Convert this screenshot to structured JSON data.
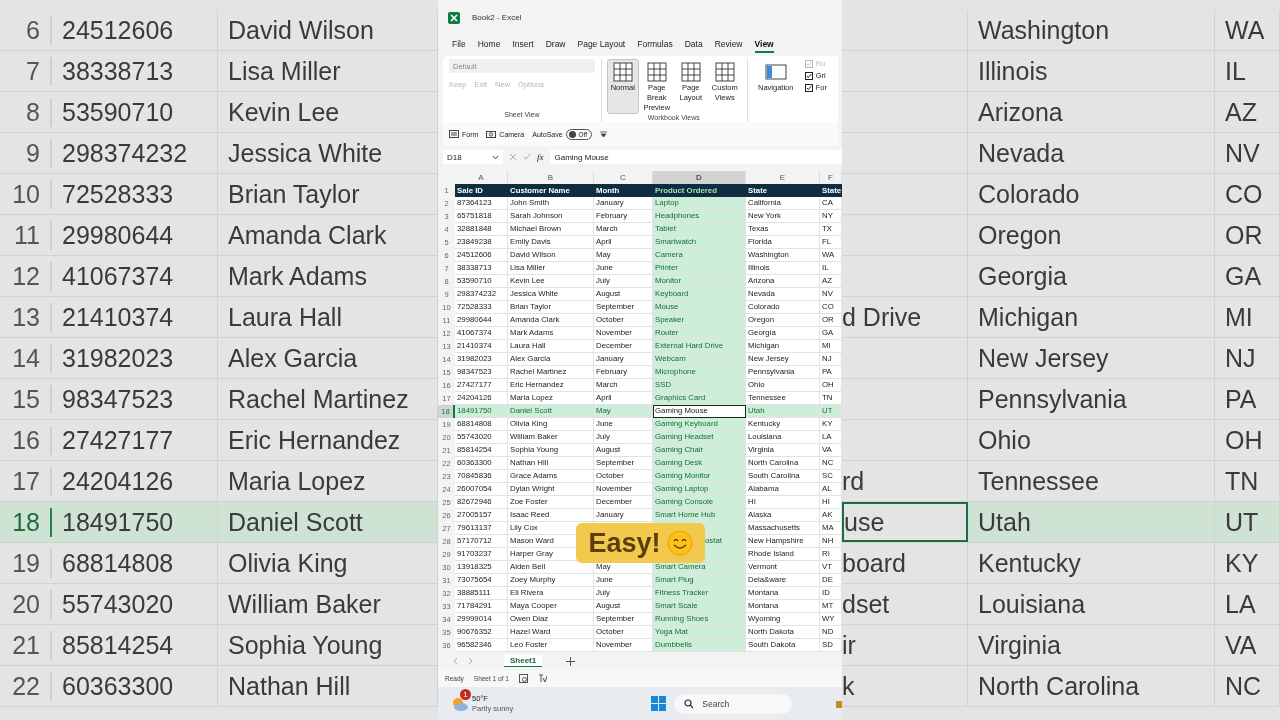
{
  "background_left": {
    "rows": [
      {
        "row": "6",
        "id": "24512606",
        "name": "David Wilson",
        "selected": false
      },
      {
        "row": "7",
        "id": "38338713",
        "name": "Lisa Miller",
        "selected": false
      },
      {
        "row": "8",
        "id": "53590710",
        "name": "Kevin Lee",
        "selected": false
      },
      {
        "row": "9",
        "id": "298374232",
        "name": "Jessica White",
        "selected": false
      },
      {
        "row": "10",
        "id": "72528333",
        "name": "Brian Taylor",
        "selected": false
      },
      {
        "row": "11",
        "id": "29980644",
        "name": "Amanda Clark",
        "selected": false
      },
      {
        "row": "12",
        "id": "41067374",
        "name": "Mark Adams",
        "selected": false
      },
      {
        "row": "13",
        "id": "21410374",
        "name": "Laura Hall",
        "selected": false
      },
      {
        "row": "14",
        "id": "31982023",
        "name": "Alex Garcia",
        "selected": false
      },
      {
        "row": "15",
        "id": "98347523",
        "name": "Rachel Martinez",
        "selected": false
      },
      {
        "row": "16",
        "id": "27427177",
        "name": "Eric Hernandez",
        "selected": false
      },
      {
        "row": "17",
        "id": "24204126",
        "name": "Maria Lopez",
        "selected": false
      },
      {
        "row": "18",
        "id": "18491750",
        "name": "Daniel Scott",
        "selected": true
      },
      {
        "row": "19",
        "id": "68814808",
        "name": "Olivia King",
        "selected": false
      },
      {
        "row": "20",
        "id": "55743020",
        "name": "William Baker",
        "selected": false
      },
      {
        "row": "21",
        "id": "85814254",
        "name": "Sophia Young",
        "selected": false
      },
      {
        "row": "22",
        "id": "60363300",
        "name": "Nathan Hill",
        "selected": false
      }
    ]
  },
  "window": {
    "title": "Book2 - Excel"
  },
  "menu": [
    {
      "label": "File",
      "selected": false
    },
    {
      "label": "Home",
      "selected": false
    },
    {
      "label": "Insert",
      "selected": false
    },
    {
      "label": "Draw",
      "selected": false
    },
    {
      "label": "Page Layout",
      "selected": false
    },
    {
      "label": "Formulas",
      "selected": false
    },
    {
      "label": "Data",
      "selected": false
    },
    {
      "label": "Review",
      "selected": false
    },
    {
      "label": "View",
      "selected": true
    }
  ],
  "ribbon": {
    "sheet_view": {
      "dropdown": "Default",
      "buttons": [
        "Keep",
        "Exit",
        "New",
        "Options"
      ],
      "label": "Sheet View"
    },
    "workbook_views": {
      "buttons": [
        {
          "label": "Normal",
          "selected": true
        },
        {
          "label": "Page Break Preview",
          "selected": false
        },
        {
          "label": "Page Layout",
          "selected": false
        },
        {
          "label": "Custom Views",
          "selected": false
        }
      ],
      "label": "Workbook Views"
    },
    "show": {
      "navigation": "Navigation",
      "checkboxes": [
        {
          "label": "Ru",
          "checked": true,
          "disabled": true
        },
        {
          "label": "Gri",
          "checked": true,
          "disabled": false
        },
        {
          "label": "For",
          "checked": true,
          "disabled": false
        }
      ]
    }
  },
  "quick_access": {
    "form": "Form",
    "camera": "Camera",
    "autosave": {
      "label": "AutoSave",
      "on": false,
      "state": "Off"
    }
  },
  "formula_bar": {
    "name_box": "D18",
    "fx": "fx",
    "value": "Gaming Mouse"
  },
  "sheet": {
    "columns": [
      {
        "letter": "A",
        "selected": false
      },
      {
        "letter": "B",
        "selected": false
      },
      {
        "letter": "C",
        "selected": false
      },
      {
        "letter": "D",
        "selected": true
      },
      {
        "letter": "E",
        "selected": false
      },
      {
        "letter": "F",
        "selected": false
      }
    ],
    "header": {
      "row": "1",
      "cells": [
        "Sale ID",
        "Customer Name",
        "Month",
        "Product Ordered",
        "State",
        "State"
      ]
    },
    "rows": [
      {
        "row": "2",
        "selected": false,
        "cells": [
          "87364123",
          "John Smith",
          "January",
          "Laptop",
          "California",
          "CA"
        ]
      },
      {
        "row": "3",
        "selected": false,
        "cells": [
          "65751818",
          "Sarah Johnson",
          "February",
          "Headphones",
          "New York",
          "NY"
        ]
      },
      {
        "row": "4",
        "selected": false,
        "cells": [
          "32881848",
          "Michael Brown",
          "March",
          "Tablet",
          "Texas",
          "TX"
        ]
      },
      {
        "row": "5",
        "selected": false,
        "cells": [
          "23849238",
          "Emily Davis",
          "April",
          "Smartwatch",
          "Florida",
          "FL"
        ]
      },
      {
        "row": "6",
        "selected": false,
        "cells": [
          "24512606",
          "David Wilson",
          "May",
          "Camera",
          "Washington",
          "WA"
        ]
      },
      {
        "row": "7",
        "selected": false,
        "cells": [
          "38338713",
          "Lisa Miller",
          "June",
          "Printer",
          "Illinois",
          "IL"
        ]
      },
      {
        "row": "8",
        "selected": false,
        "cells": [
          "53590710",
          "Kevin Lee",
          "July",
          "Monitor",
          "Arizona",
          "AZ"
        ]
      },
      {
        "row": "9",
        "selected": false,
        "cells": [
          "298374232",
          "Jessica White",
          "August",
          "Keyboard",
          "Nevada",
          "NV"
        ]
      },
      {
        "row": "10",
        "selected": false,
        "cells": [
          "72528333",
          "Brian Taylor",
          "September",
          "Mouse",
          "Colorado",
          "CO"
        ]
      },
      {
        "row": "11",
        "selected": false,
        "cells": [
          "29980644",
          "Amanda Clark",
          "October",
          "Speaker",
          "Oregon",
          "OR"
        ]
      },
      {
        "row": "12",
        "selected": false,
        "cells": [
          "41067374",
          "Mark Adams",
          "November",
          "Router",
          "Georgia",
          "GA"
        ]
      },
      {
        "row": "13",
        "selected": false,
        "cells": [
          "21410374",
          "Laura Hall",
          "December",
          "External Hard Drive",
          "Michigan",
          "MI"
        ]
      },
      {
        "row": "14",
        "selected": false,
        "cells": [
          "31982023",
          "Alex Garcia",
          "January",
          "Webcam",
          "New Jersey",
          "NJ"
        ]
      },
      {
        "row": "15",
        "selected": false,
        "cells": [
          "98347523",
          "Rachel Martinez",
          "February",
          "Microphone",
          "Pennsylvania",
          "PA"
        ]
      },
      {
        "row": "16",
        "selected": false,
        "cells": [
          "27427177",
          "Eric Hernandez",
          "March",
          "SSD",
          "Ohio",
          "OH"
        ]
      },
      {
        "row": "17",
        "selected": false,
        "cells": [
          "24204126",
          "Maria Lopez",
          "April",
          "Graphics Card",
          "Tennessee",
          "TN"
        ]
      },
      {
        "row": "18",
        "selected": true,
        "cells": [
          "18491750",
          "Daniel Scott",
          "May",
          "Gaming Mouse",
          "Utah",
          "UT"
        ]
      },
      {
        "row": "19",
        "selected": false,
        "cells": [
          "68814808",
          "Olivia King",
          "June",
          "Gaming Keyboard",
          "Kentucky",
          "KY"
        ]
      },
      {
        "row": "20",
        "selected": false,
        "cells": [
          "55743020",
          "William Baker",
          "July",
          "Gaming Headset",
          "Louisiana",
          "LA"
        ]
      },
      {
        "row": "21",
        "selected": false,
        "cells": [
          "85814254",
          "Sophia Young",
          "August",
          "Gaming Chair",
          "Virginia",
          "VA"
        ]
      },
      {
        "row": "22",
        "selected": false,
        "cells": [
          "60363300",
          "Nathan Hill",
          "September",
          "Gaming Desk",
          "North Carolina",
          "NC"
        ]
      },
      {
        "row": "23",
        "selected": false,
        "cells": [
          "70845836",
          "Grace Adams",
          "October",
          "Gaming Monitor",
          "South Carolina",
          "SC"
        ]
      },
      {
        "row": "24",
        "selected": false,
        "cells": [
          "26007054",
          "Dylan Wright",
          "November",
          "Gaming Laptop",
          "Alabama",
          "AL"
        ]
      },
      {
        "row": "25",
        "selected": false,
        "cells": [
          "82672946",
          "Zoe Foster",
          "December",
          "Gaming Console",
          "HI",
          "HI"
        ]
      },
      {
        "row": "26",
        "selected": false,
        "cells": [
          "27005157",
          "Isaac Reed",
          "January",
          "Smart Home Hub",
          "Alaska",
          "AK"
        ]
      },
      {
        "row": "27",
        "selected": false,
        "cells": [
          "79613137",
          "Lily Cox",
          null,
          null,
          "Massachusetts",
          "MA"
        ]
      },
      {
        "row": "28",
        "selected": false,
        "cells": [
          "57170712",
          "Mason Ward",
          null,
          {
            "text": "ostat",
            "covered_left": true
          },
          "New Hampshire",
          "NH"
        ]
      },
      {
        "row": "29",
        "selected": false,
        "cells": [
          "91703237",
          "Harper Gray",
          null,
          null,
          "Rhode Island",
          "RI"
        ]
      },
      {
        "row": "30",
        "selected": false,
        "cells": [
          "13918325",
          "Aiden Bell",
          "May",
          "Smart Camera",
          "Vermont",
          "VT"
        ]
      },
      {
        "row": "31",
        "selected": false,
        "cells": [
          "73075654",
          "Zoey Murphy",
          "June",
          "Smart Plug",
          "Dela&ware",
          "DE"
        ]
      },
      {
        "row": "32",
        "selected": false,
        "cells": [
          "38885111",
          "Eli Rivera",
          "July",
          "Fitness Tracker",
          "Montana",
          "ID"
        ]
      },
      {
        "row": "33",
        "selected": false,
        "cells": [
          "71784291",
          "Maya Cooper",
          "August",
          "Smart Scale",
          "Montana",
          "MT"
        ]
      },
      {
        "row": "34",
        "selected": false,
        "cells": [
          "29999014",
          "Owen Diaz",
          "September",
          "Running Shoes",
          "Wyoming",
          "WY"
        ]
      },
      {
        "row": "35",
        "selected": false,
        "cells": [
          "90676352",
          "Hazel Ward",
          "October",
          "Yoga Mat",
          "North Dakota",
          "ND"
        ]
      },
      {
        "row": "36",
        "selected": false,
        "cells": [
          "96582346",
          "Leo Foster",
          "November",
          "Dumbbells",
          "South Dakota",
          "SD"
        ]
      }
    ]
  },
  "caption": {
    "text": "Easy!"
  },
  "sheet_tabs": [
    {
      "label": "Sheet1",
      "selected": true
    }
  ],
  "status_bar": {
    "mode": "Ready",
    "sheet_count": "Sheet 1 of 1"
  },
  "taskbar": {
    "weather": {
      "badge": "1",
      "temperature": "50°F",
      "condition": "Partly sunny"
    },
    "search": "Search"
  },
  "background_right": {
    "rows": [
      {
        "state": "Washington",
        "abbr": "WA",
        "selected": false
      },
      {
        "state": "Illinois",
        "abbr": "IL",
        "selected": false
      },
      {
        "state": "Arizona",
        "abbr": "AZ",
        "selected": false
      },
      {
        "state": "Nevada",
        "abbr": "NV",
        "selected": false
      },
      {
        "state": "Colorado",
        "abbr": "CO",
        "selected": false
      },
      {
        "state": "Oregon",
        "abbr": "OR",
        "selected": false
      },
      {
        "state": "Georgia",
        "abbr": "GA",
        "selected": false
      },
      {
        "product": "d Drive",
        "state": "Michigan",
        "abbr": "MI",
        "selected": false
      },
      {
        "state": "New Jersey",
        "abbr": "NJ",
        "selected": false
      },
      {
        "state": "Pennsylvania",
        "abbr": "PA",
        "selected": false
      },
      {
        "state": "Ohio",
        "abbr": "OH",
        "selected": false
      },
      {
        "product": "rd",
        "state": "Tennessee",
        "abbr": "TN",
        "selected": false
      },
      {
        "product": "use",
        "state": "Utah",
        "abbr": "UT",
        "selected": true
      },
      {
        "product": "board",
        "state": "Kentucky",
        "abbr": "KY",
        "selected": false
      },
      {
        "product": "dset",
        "state": "Louisiana",
        "abbr": "LA",
        "selected": false
      },
      {
        "product": "ir",
        "state": "Virginia",
        "abbr": "VA",
        "selected": false
      },
      {
        "product": "k",
        "state": "North Carolina",
        "abbr": "NC",
        "selected": false
      }
    ]
  }
}
